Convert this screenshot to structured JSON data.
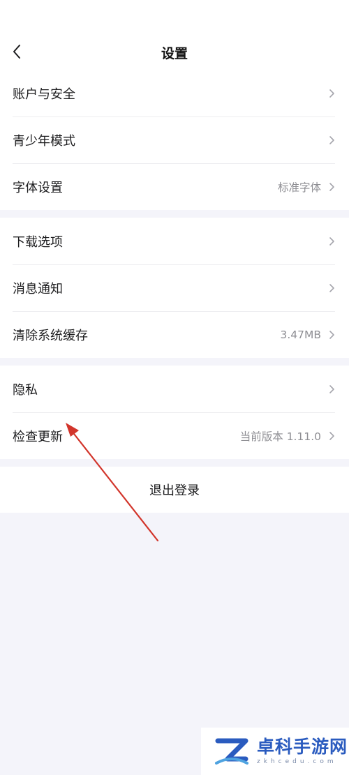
{
  "header": {
    "title": "设置"
  },
  "groups": [
    {
      "items": [
        {
          "label": "账户与安全",
          "value": ""
        },
        {
          "label": "青少年模式",
          "value": ""
        },
        {
          "label": "字体设置",
          "value": "标准字体"
        }
      ]
    },
    {
      "items": [
        {
          "label": "下载选项",
          "value": ""
        },
        {
          "label": "消息通知",
          "value": ""
        },
        {
          "label": "清除系统缓存",
          "value": "3.47MB"
        }
      ]
    },
    {
      "items": [
        {
          "label": "隐私",
          "value": ""
        },
        {
          "label": "检查更新",
          "value": "当前版本 1.11.0"
        }
      ]
    }
  ],
  "logout": {
    "label": "退出登录"
  },
  "watermark": {
    "name": "卓科手游网",
    "domain": "zkhcedu.com"
  },
  "colors": {
    "background": "#f4f4fa",
    "annotation_arrow": "#d2352b",
    "watermark_brand": "#2a5bbf"
  }
}
